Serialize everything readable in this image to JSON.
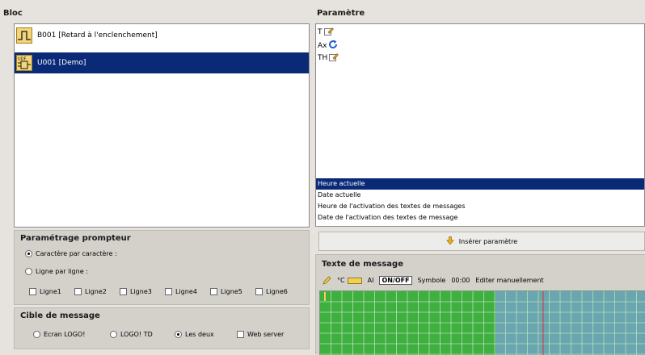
{
  "bloc": {
    "title": "Bloc",
    "items": [
      {
        "label": "B001 [Retard à l'enclenchement]",
        "icon": "on-delay-timer-icon"
      },
      {
        "label": "U001 [Demo]",
        "icon": "udf-block-icon",
        "icon_text": "UDF"
      }
    ],
    "selected_index": 1
  },
  "parametre": {
    "title": "Paramètre",
    "params": [
      {
        "label": "T",
        "icon": "edit-icon"
      },
      {
        "label": "Ax",
        "icon": "refresh-icon"
      },
      {
        "label": "TH",
        "icon": "edit-icon"
      }
    ],
    "list": [
      "Heure actuelle",
      "Date actuelle",
      "Heure de l'activation des textes de messages",
      "Date de l'activation des textes de message"
    ],
    "selected_index": 0
  },
  "prompteur": {
    "title": "Paramétrage prompteur",
    "radio_char": "Caractère par caractère :",
    "radio_line": "Ligne par ligne :",
    "selected": "char",
    "lines": [
      "Ligne1",
      "Ligne2",
      "Ligne3",
      "Ligne4",
      "Ligne5",
      "Ligne6"
    ]
  },
  "cible": {
    "title": "Cible de message",
    "options": [
      "Ecran LOGO!",
      "LOGO! TD",
      "Les deux"
    ],
    "selected": "Les deux",
    "web_server": "Web server"
  },
  "inserer": {
    "label": "Insérer paramètre",
    "icon": "arrow-down-icon"
  },
  "message": {
    "title": "Texte de message",
    "toolbar": {
      "pencil_icon": "pencil-icon",
      "degree": "°C",
      "ai": "AI",
      "onoff": "ON/OFF",
      "symbole": "Symbole",
      "time": "00:00",
      "editer": "Editer manuellement"
    }
  },
  "colors": {
    "selection": "#0a2a78",
    "grid_green": "#3fb03f",
    "grid_teal": "#6aa6b0",
    "grid_red": "#e03030"
  }
}
